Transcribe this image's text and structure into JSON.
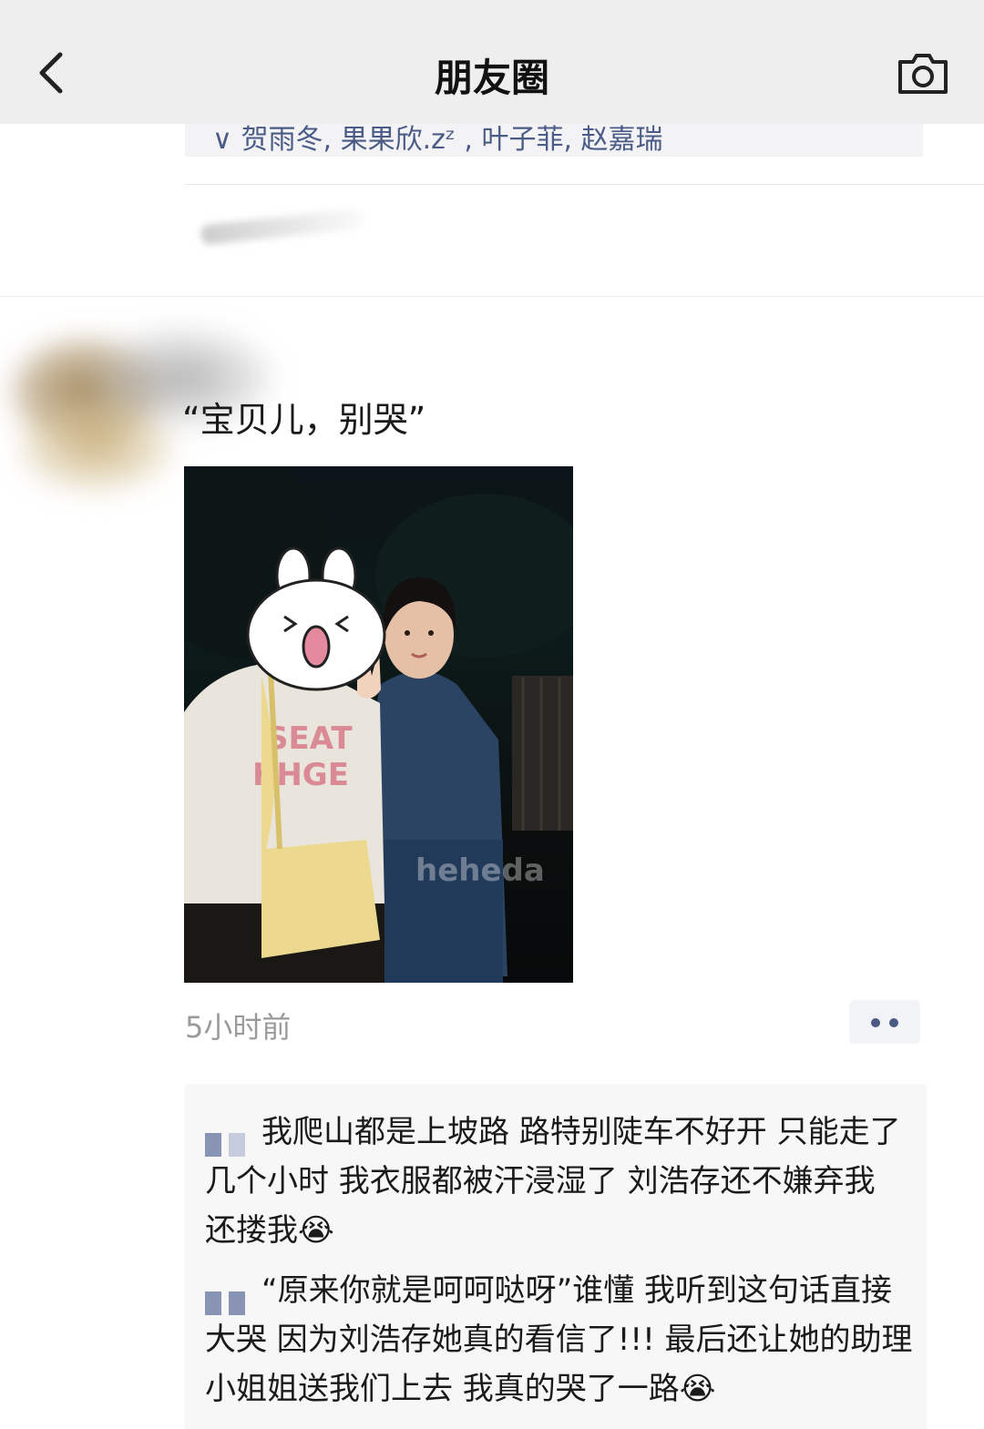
{
  "header": {
    "title": "朋友圈",
    "back_icon": "chevron-left-icon",
    "camera_icon": "camera-icon"
  },
  "previous_post": {
    "likes_text": "∨ 贺雨冬, 果果欣.zᶻ , 叶子菲, 赵嘉瑞"
  },
  "post": {
    "text": "“宝贝儿，别哭”",
    "photo_watermark": "heheda",
    "timestamp": "5小时前",
    "more_icon": "more-dots-icon"
  },
  "comments": [
    {
      "text": "我爬山都是上坡路 路特别陡车不好开 只能走了几个小时 我衣服都被汗浸湿了 刘浩存还不嫌弃我 还搂我😭"
    },
    {
      "text": "“原来你就是呵呵哒呀”谁懂 我听到这句话直接大哭 因为刘浩存她真的看信了!!! 最后还让她的助理小姐姐送我们上去 我真的哭了一路😭"
    }
  ],
  "colors": {
    "header_bg": "#eeeeee",
    "link_blue": "#4a5b86",
    "comment_bg": "#f7f7f7",
    "timestamp_gray": "#9a9a9a"
  }
}
